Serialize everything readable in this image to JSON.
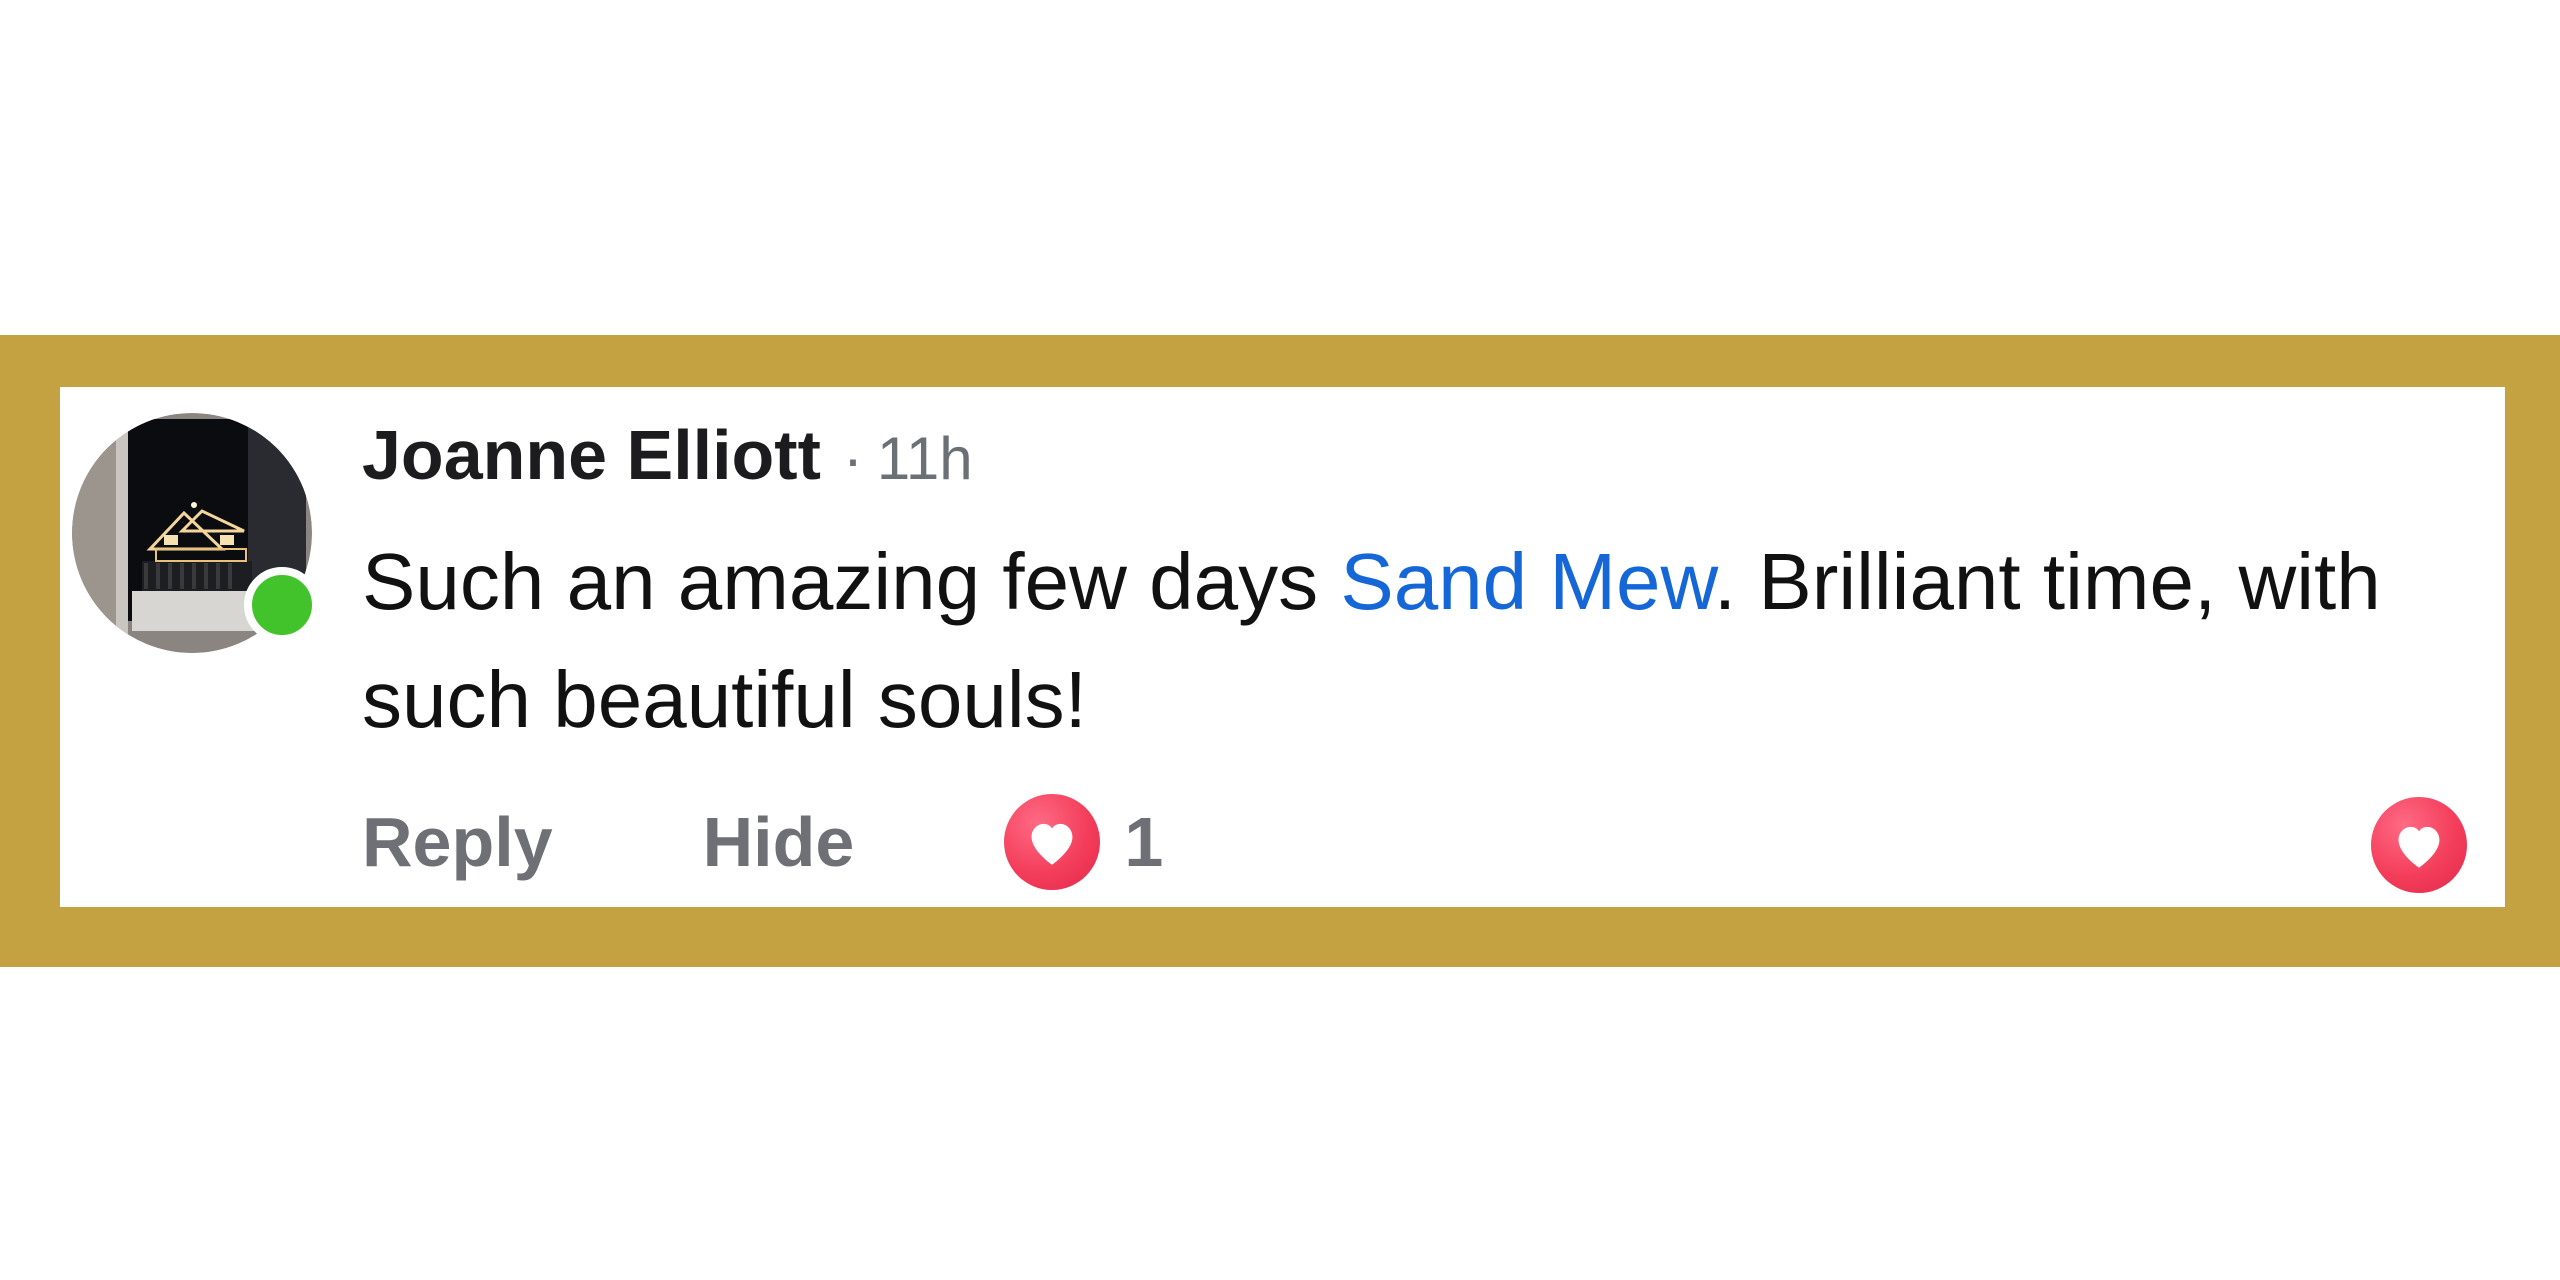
{
  "comment": {
    "author": "Joanne Elliott",
    "separator": "·",
    "timestamp": "11h",
    "text_before": "Such an amazing few days ",
    "mention": "Sand Mew",
    "text_after": ". Brilliant time, with such beautiful souls!"
  },
  "actions": {
    "reply_label": "Reply",
    "hide_label": "Hide",
    "reaction_count": "1"
  },
  "icons": {
    "reaction": "heart-icon",
    "like": "heart-icon",
    "online": "online-status-icon"
  },
  "colors": {
    "frame": "#c4a242",
    "mention": "#1566d6",
    "heart": "#f33e5b",
    "online": "#42c32b"
  }
}
